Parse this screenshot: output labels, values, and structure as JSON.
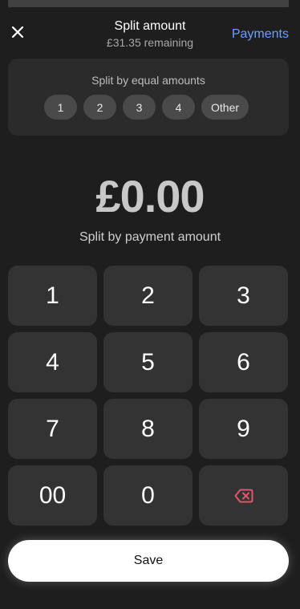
{
  "header": {
    "title": "Split amount",
    "subtitle": "£31.35 remaining",
    "payments_label": "Payments",
    "close_icon": "close-icon"
  },
  "equal_split": {
    "label": "Split by equal amounts",
    "options": [
      "1",
      "2",
      "3",
      "4",
      "Other"
    ]
  },
  "amount": {
    "value": "£0.00",
    "caption": "Split by payment amount"
  },
  "keypad": {
    "keys": [
      "1",
      "2",
      "3",
      "4",
      "5",
      "6",
      "7",
      "8",
      "9",
      "00",
      "0"
    ],
    "backspace_icon": "backspace-icon"
  },
  "save_label": "Save",
  "colors": {
    "accent": "#6aa0ff",
    "backspace": "#e0566e",
    "background": "#1e1e1e",
    "key_background": "#333333"
  }
}
